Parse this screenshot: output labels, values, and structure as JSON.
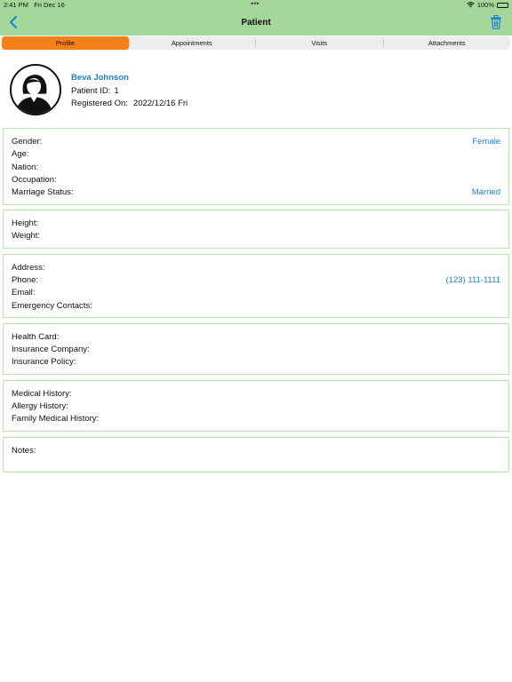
{
  "status_bar": {
    "time": "2:41 PM",
    "date": "Fri Dec 16",
    "battery": "100%"
  },
  "nav": {
    "title": "Patient",
    "back_icon": "chevron-left-icon",
    "trash_icon": "trash-icon",
    "accent_color": "#1a82d6",
    "header_color": "#a5d79a"
  },
  "tabs": [
    {
      "label": "Profile",
      "active": true
    },
    {
      "label": "Appointments",
      "active": false
    },
    {
      "label": "Visits",
      "active": false
    },
    {
      "label": "Attachments",
      "active": false
    }
  ],
  "patient": {
    "name": "Beva Johnson",
    "id_label": "Patient ID:",
    "id_value": "1",
    "registered_label": "Registered On:",
    "registered_value": "2022/12/16 Fri"
  },
  "sections": {
    "basic": {
      "gender_label": "Gender:",
      "gender_value": "Female",
      "age_label": "Age:",
      "nation_label": "Nation:",
      "occupation_label": "Occupation:",
      "marriage_label": "Marriage Status:",
      "marriage_value": "Married"
    },
    "body": {
      "height_label": "Height:",
      "weight_label": "Weight:"
    },
    "contact": {
      "address_label": "Address:",
      "phone_label": "Phone:",
      "phone_value": "(123) 111-1111",
      "email_label": "Email:",
      "emergency_label": "Emergency Contacts:"
    },
    "insurance": {
      "health_card_label": "Health Card:",
      "insurance_company_label": "Insurance Company:",
      "insurance_policy_label": "Insurance Policy:"
    },
    "history": {
      "medical_label": "Medical History:",
      "allergy_label": "Allergy History:",
      "family_label": "Family Medical History:"
    },
    "notes": {
      "notes_label": "Notes:"
    }
  }
}
